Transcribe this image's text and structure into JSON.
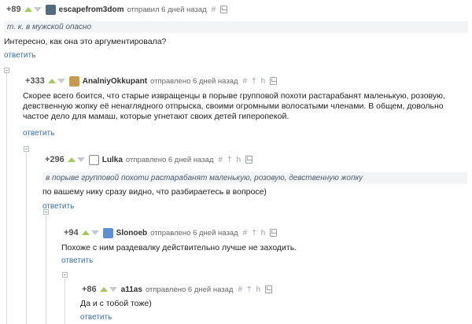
{
  "comments": [
    {
      "rating": "+89",
      "username": "escapefrom3dom",
      "meta": "отправил 6 дней назад",
      "quote": "т. к. в мужской опасно",
      "text": "Интересно, как она это аргументировала?",
      "reply": "ответить"
    },
    {
      "rating": "+333",
      "username": "AnalniyOkkupant",
      "meta": "отправлено 6 дней назад",
      "text": "Скорее всего боится, что старые извращенцы в порыве групповой похоти растарабанят маленькую, розовую, девственную жопку её ненаглядного отпрыска, своими огромными волосатыми членами. В общем, довольно частое дело для мамаш, которые угнетают своих детей гиперопекой.",
      "reply": "ответить"
    },
    {
      "rating": "+296",
      "username": "Lulka",
      "meta": "отправлено 6 дней назад",
      "quote": "в порыве групповой похоти растарабанят маленькую, розовую, девственную жопку",
      "text": "по вашему нику сразу видно, что разбираетесь в вопросе)",
      "reply": "ответить"
    },
    {
      "rating": "+94",
      "username": "Slonoeb",
      "meta": "отправлено 6 дней назад",
      "text": "Похоже с ним раздевалку действительно лучше не заходить.",
      "reply": "ответить"
    },
    {
      "rating": "+86",
      "username": "a11as",
      "meta": "отправлено 6 дней назад",
      "text": "Да и с тобой тоже)",
      "reply": "ответить"
    }
  ],
  "icons": {
    "link": "#",
    "dagger": "†",
    "parent": "h"
  },
  "colors": {
    "vote_up": "#a5c75f",
    "vote_down": "#c5cad0",
    "reply_link": "#3a6ea5",
    "quote_bg": "#f3f4f6"
  }
}
